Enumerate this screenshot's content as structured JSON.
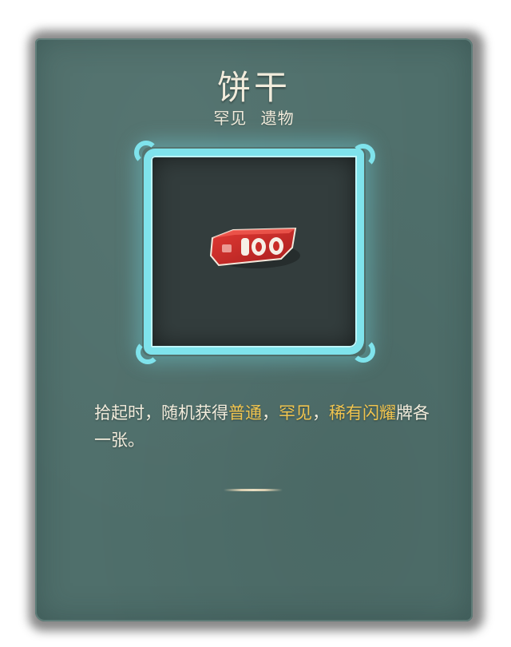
{
  "card": {
    "title": "饼干",
    "rarity": "罕见",
    "category": "遗物",
    "relic_icon": "red-biscuit-icon",
    "colors": {
      "card_bg": "#4f6f6b",
      "frame": "#7fe3ec",
      "keyword": "#f0c44f",
      "text": "#f2ecdc"
    }
  },
  "description": {
    "part1": "拾起时，随机获得",
    "kw1": "普通",
    "sep1": "，",
    "kw2": "罕见",
    "sep2": "，",
    "kw3": "稀有闪耀",
    "part2": "牌各一张。"
  }
}
